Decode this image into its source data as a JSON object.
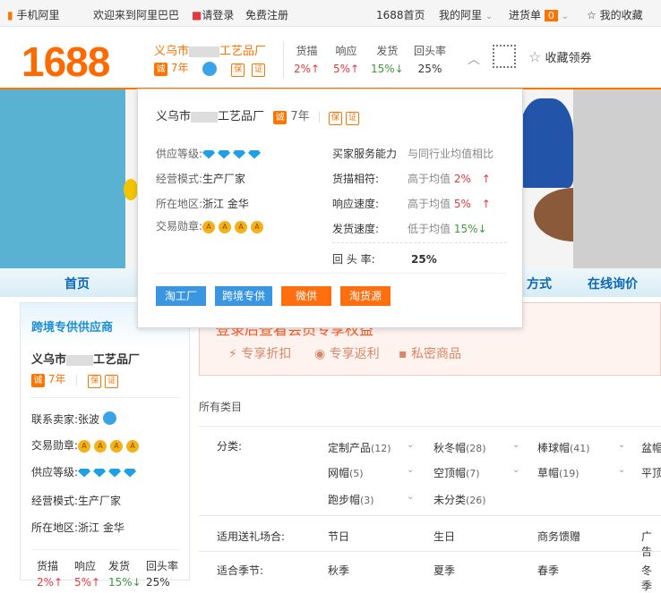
{
  "topbar": {
    "mobile": "手机阿里",
    "welcome": "欢迎来到阿里巴巴",
    "login": "请登录",
    "register": "免费注册",
    "home": "1688首页",
    "my_ali": "我的阿里",
    "purchase": "进货单",
    "purchase_count": "0",
    "favorites": "我的收藏"
  },
  "header": {
    "logo": "1688",
    "shop_name": "义乌市",
    "shop_name_suffix": "工艺品厂",
    "years": "7年",
    "stats": [
      {
        "label": "货描",
        "value": "2%↑",
        "color": "red"
      },
      {
        "label": "响应",
        "value": "5%↑",
        "color": "red"
      },
      {
        "label": "发货",
        "value": "15%↓",
        "color": "green"
      },
      {
        "label": "回头率",
        "value": "25%",
        "color": "plain"
      }
    ],
    "collect": "收藏领券"
  },
  "popup": {
    "shop_name": "义乌市",
    "shop_name_suffix": "工艺品厂",
    "years": "7年",
    "supply_level_label": "供应等级:",
    "mode_label": "经营模式:",
    "mode_value": "生产厂家",
    "region_label": "所在地区:",
    "region_value": "浙江 金华",
    "medal_label": "交易勋章:",
    "service_title": "买家服务能力",
    "service_compare": "与同行业均值相比",
    "metrics": [
      {
        "label": "货描相符:",
        "desc": "高于均值",
        "value": "2%",
        "arrow": "↑",
        "color": "red"
      },
      {
        "label": "响应速度:",
        "desc": "高于均值",
        "value": "5%",
        "arrow": "↑",
        "color": "red"
      },
      {
        "label": "发货速度:",
        "desc": "低于均值",
        "value": "15%",
        "arrow": "↓",
        "color": "green"
      }
    ],
    "return_label": "回 头 率:",
    "return_value": "25%",
    "buttons": [
      "淘工厂",
      "跨境专供",
      "微供",
      "淘货源"
    ]
  },
  "nav": {
    "home": "首页",
    "contact": "方式",
    "inquiry": "在线询价"
  },
  "left": {
    "title": "跨境专供供应商",
    "shop_name": "义乌市",
    "shop_name_suffix": "工艺品厂",
    "years": "7年",
    "contact_label": "联系卖家:",
    "contact_value": "张波",
    "medal_label": "交易勋章:",
    "supply_label": "供应等级:",
    "mode_label": "经营模式:",
    "mode_value": "生产厂家",
    "region_label": "所在地区:",
    "region_value": "浙江 金华",
    "stats": [
      {
        "label": "货描",
        "value": "2%↑"
      },
      {
        "label": "响应",
        "value": "5%↑"
      },
      {
        "label": "发货",
        "value": "15%↓"
      },
      {
        "label": "回头率",
        "value": "25%"
      }
    ]
  },
  "promo": {
    "headline": "登录后查看会员专享权益",
    "items": [
      "专享折扣",
      "专享返利",
      "私密商品"
    ]
  },
  "categories": {
    "all": "所有类目",
    "class_label": "分类:",
    "items": [
      {
        "name": "定制产品",
        "count": "(12)"
      },
      {
        "name": "秋冬帽",
        "count": "(28)"
      },
      {
        "name": "棒球帽",
        "count": "(41)"
      },
      {
        "name": "盆帽",
        "count": ""
      },
      {
        "name": "网帽",
        "count": "(5)"
      },
      {
        "name": "空顶帽",
        "count": "(7)"
      },
      {
        "name": "草帽",
        "count": "(19)"
      },
      {
        "name": "平顶",
        "count": ""
      },
      {
        "name": "跑步帽",
        "count": "(3)"
      },
      {
        "name": "未分类",
        "count": "(26)"
      }
    ],
    "occasion_label": "适用送礼场合:",
    "occasions": [
      "节日",
      "生日",
      "商务馈赠",
      "广告"
    ],
    "season_label": "适合季节:",
    "seasons": [
      "秋季",
      "夏季",
      "春季",
      "冬季"
    ]
  }
}
